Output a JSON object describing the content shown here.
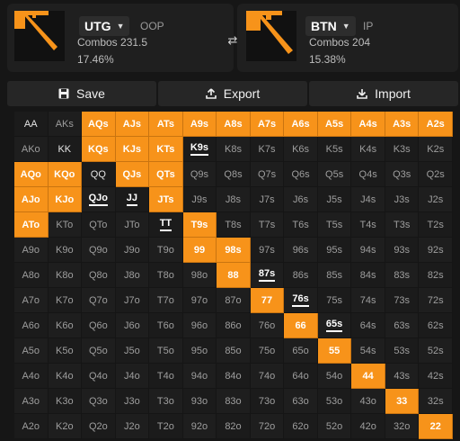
{
  "left_panel": {
    "position": "UTG",
    "tag": "OOP",
    "combos": "Combos 231.5",
    "percent": "17.46%"
  },
  "right_panel": {
    "position": "BTN",
    "tag": "IP",
    "combos": "Combos 204",
    "percent": "15.38%"
  },
  "toolbar": {
    "save": "Save",
    "export": "Export",
    "import": "Import"
  },
  "colors": {
    "selected": "#f7931a",
    "background": "#161616"
  },
  "grid": {
    "ranks": [
      "A",
      "K",
      "Q",
      "J",
      "T",
      "9",
      "8",
      "7",
      "6",
      "5",
      "4",
      "3",
      "2"
    ],
    "hands": [
      [
        "AA",
        "AKs",
        "AQs",
        "AJs",
        "ATs",
        "A9s",
        "A8s",
        "A7s",
        "A6s",
        "A5s",
        "A4s",
        "A3s",
        "A2s"
      ],
      [
        "AKo",
        "KK",
        "KQs",
        "KJs",
        "KTs",
        "K9s",
        "K8s",
        "K7s",
        "K6s",
        "K5s",
        "K4s",
        "K3s",
        "K2s"
      ],
      [
        "AQo",
        "KQo",
        "QQ",
        "QJs",
        "QTs",
        "Q9s",
        "Q8s",
        "Q7s",
        "Q6s",
        "Q5s",
        "Q4s",
        "Q3s",
        "Q2s"
      ],
      [
        "AJo",
        "KJo",
        "QJo",
        "JJ",
        "JTs",
        "J9s",
        "J8s",
        "J7s",
        "J6s",
        "J5s",
        "J4s",
        "J3s",
        "J2s"
      ],
      [
        "ATo",
        "KTo",
        "QTo",
        "JTo",
        "TT",
        "T9s",
        "T8s",
        "T7s",
        "T6s",
        "T5s",
        "T4s",
        "T3s",
        "T2s"
      ],
      [
        "A9o",
        "K9o",
        "Q9o",
        "J9o",
        "T9o",
        "99",
        "98s",
        "97s",
        "96s",
        "95s",
        "94s",
        "93s",
        "92s"
      ],
      [
        "A8o",
        "K8o",
        "Q8o",
        "J8o",
        "T8o",
        "98o",
        "88",
        "87s",
        "86s",
        "85s",
        "84s",
        "83s",
        "82s"
      ],
      [
        "A7o",
        "K7o",
        "Q7o",
        "J7o",
        "T7o",
        "97o",
        "87o",
        "77",
        "76s",
        "75s",
        "74s",
        "73s",
        "72s"
      ],
      [
        "A6o",
        "K6o",
        "Q6o",
        "J6o",
        "T6o",
        "96o",
        "86o",
        "76o",
        "66",
        "65s",
        "64s",
        "63s",
        "62s"
      ],
      [
        "A5o",
        "K5o",
        "Q5o",
        "J5o",
        "T5o",
        "95o",
        "85o",
        "75o",
        "65o",
        "55",
        "54s",
        "53s",
        "52s"
      ],
      [
        "A4o",
        "K4o",
        "Q4o",
        "J4o",
        "T4o",
        "94o",
        "84o",
        "74o",
        "64o",
        "54o",
        "44",
        "43s",
        "42s"
      ],
      [
        "A3o",
        "K3o",
        "Q3o",
        "J3o",
        "T3o",
        "93o",
        "83o",
        "73o",
        "63o",
        "53o",
        "43o",
        "33",
        "32s"
      ],
      [
        "A2o",
        "K2o",
        "Q2o",
        "J2o",
        "T2o",
        "92o",
        "82o",
        "72o",
        "62o",
        "52o",
        "42o",
        "32o",
        "22"
      ]
    ],
    "selected": [
      "AQs",
      "AJs",
      "ATs",
      "A9s",
      "A8s",
      "A7s",
      "A6s",
      "A5s",
      "A4s",
      "A3s",
      "A2s",
      "KQs",
      "KJs",
      "KTs",
      "AQo",
      "KQo",
      "QJs",
      "QTs",
      "AJo",
      "KJo",
      "JTs",
      "ATo",
      "T9s",
      "99",
      "98s",
      "88",
      "77",
      "66",
      "55",
      "44",
      "33",
      "22"
    ],
    "partial": [
      "K9s",
      "QJo",
      "JJ",
      "TT",
      "87s",
      "76s",
      "65s"
    ]
  }
}
